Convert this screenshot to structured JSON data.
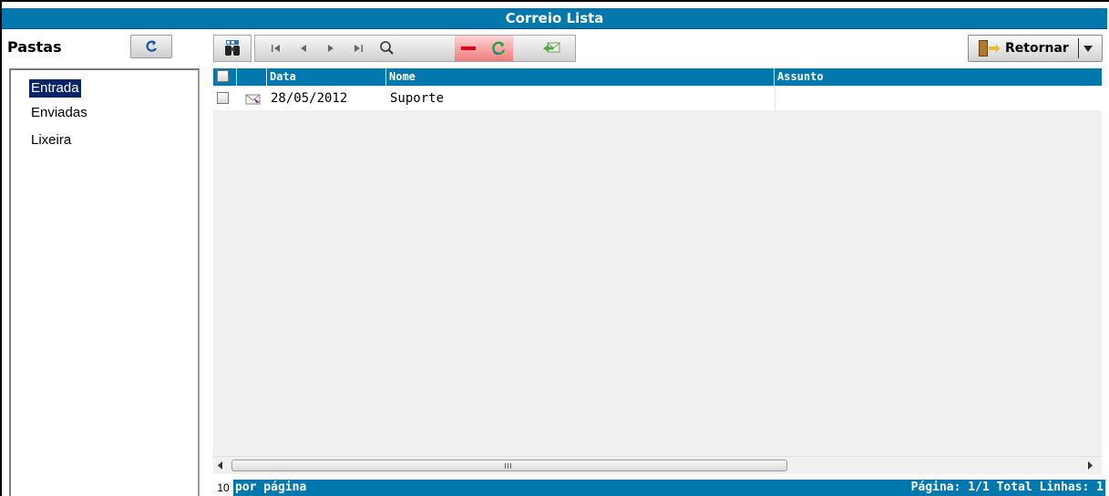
{
  "window": {
    "title": "Correio Lista"
  },
  "sidebar": {
    "title": "Pastas",
    "folders": [
      {
        "label": "Entrada",
        "selected": true
      },
      {
        "label": "Enviadas"
      },
      {
        "label": "Lixeira"
      }
    ]
  },
  "toolbar": {
    "nav_icons": [
      "first-page-icon",
      "previous-page-icon",
      "next-page-icon",
      "last-page-icon",
      "search-icon",
      "delete-icon",
      "refresh-icon",
      "move-icon"
    ],
    "retornar_label": "Retornar"
  },
  "grid": {
    "columns": [
      "",
      "",
      "Data",
      "Nome",
      "Assunto"
    ],
    "rows": [
      {
        "data": "28/05/2012",
        "nome": "Suporte",
        "assunto": ""
      }
    ]
  },
  "footer": {
    "per_page_value": "10",
    "per_page_label": "por página",
    "status": "Página: 1/1 Total Linhas: 1"
  },
  "colors": {
    "accent": "#0077ad",
    "selection": "#0a246a"
  }
}
